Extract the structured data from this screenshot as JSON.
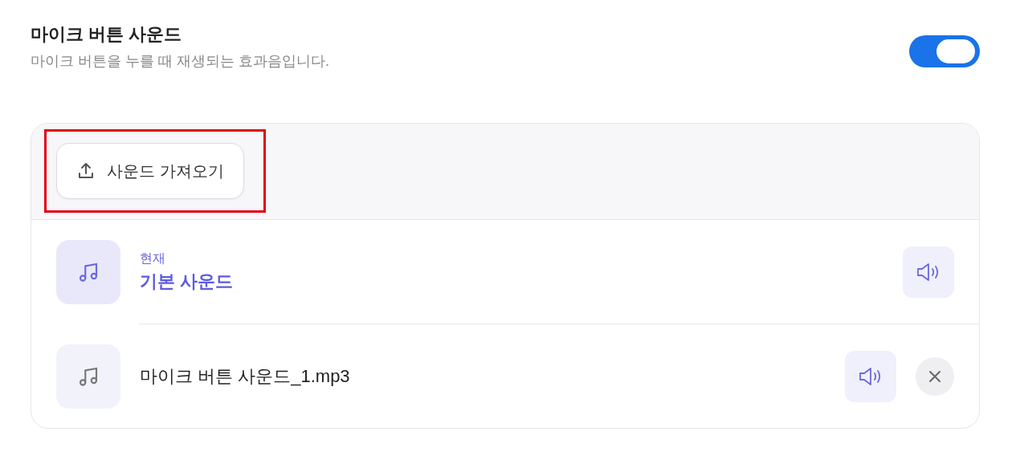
{
  "setting": {
    "title": "마이크 버튼 사운드",
    "description": "마이크 버튼을 누를 때 재생되는 효과음입니다.",
    "on": true
  },
  "import_button": {
    "label": "사운드 가져오기",
    "highlighted": true
  },
  "sounds": [
    {
      "caption": "현재",
      "name": "기본 사운드",
      "selected": true,
      "removable": false
    },
    {
      "name": "마이크 버튼 사운드_1.mp3",
      "selected": false,
      "removable": true
    }
  ]
}
